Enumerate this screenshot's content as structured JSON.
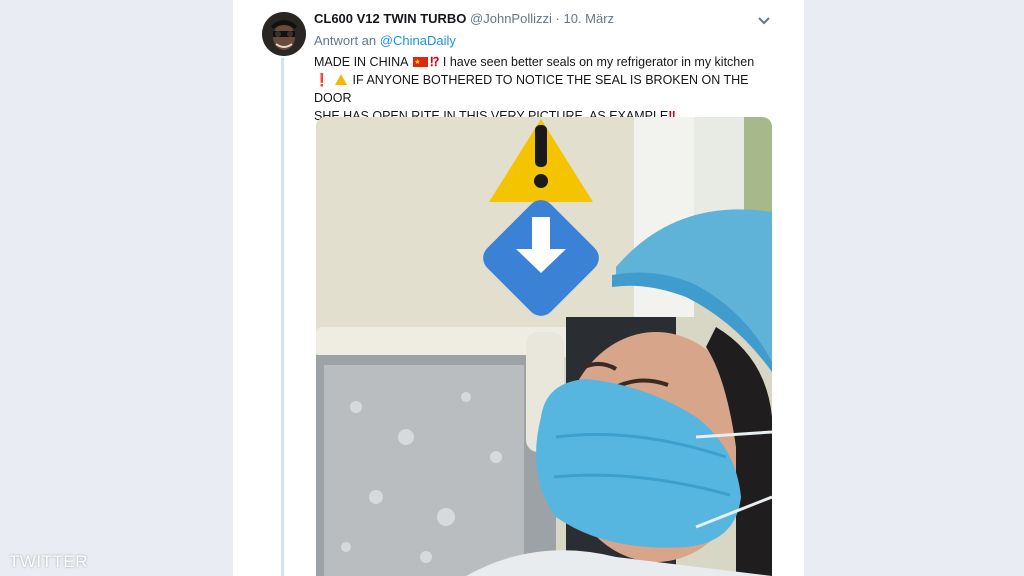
{
  "tweet": {
    "display_name": "CL600 V12 TWIN TURBO",
    "handle": "@JohnPollizzi",
    "separator": "·",
    "date": "10. März",
    "reply_prefix": "Antwort an",
    "reply_mention": "@ChinaDaily",
    "text_line1_a": "MADE IN CHINA",
    "text_line1_b": "I have seen better seals on my refrigerator in my kitchen",
    "text_line2": "IF ANYONE BOTHERED TO NOTICE THE SEAL IS BROKEN ON THE DOOR",
    "text_line3": "SHE HAS OPEN RITE IN THIS VERY PICTURE, AS EXAMPLE",
    "emoji_interrobang": "⁉",
    "emoji_exclamation": "❗",
    "emoji_double_exclamation": "‼",
    "icons": {
      "avatar": "avatar",
      "more": "chevron-down-icon",
      "flag": "china-flag-icon",
      "warning": "warning-icon",
      "arrow": "down-arrow-icon"
    }
  },
  "watermark": "TWITTER",
  "colors": {
    "background": "#e9edf3",
    "card": "#ffffff",
    "link": "#1b95e0",
    "thread_line": "#cfe3f2",
    "warning": "#f5b800",
    "arrow_badge": "#3b82d6"
  }
}
